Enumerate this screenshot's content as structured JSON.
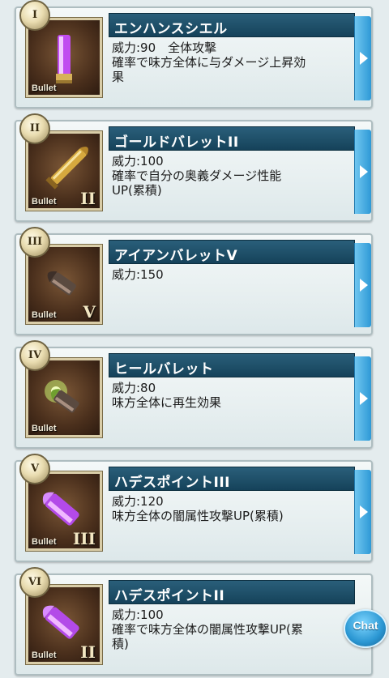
{
  "bullets": [
    {
      "slot": "I",
      "name": "エンハンスシエル",
      "lines": [
        "威力:90　全体攻撃",
        "確率で味方全体に与ダメージ上昇効",
        "果"
      ],
      "thumb_label": "Bullet",
      "grade": "",
      "icon": "shell-purple-icon"
    },
    {
      "slot": "II",
      "name": "ゴールドバレットII",
      "lines": [
        "威力:100",
        "確率で自分の奥義ダメージ性能",
        "UP(累積)"
      ],
      "thumb_label": "Bullet",
      "grade": "II",
      "icon": "gold-bullet-icon"
    },
    {
      "slot": "III",
      "name": "アイアンバレットV",
      "lines": [
        "威力:150"
      ],
      "thumb_label": "Bullet",
      "grade": "V",
      "icon": "iron-bullet-icon"
    },
    {
      "slot": "IV",
      "name": "ヒールバレット",
      "lines": [
        "威力:80",
        "味方全体に再生効果"
      ],
      "thumb_label": "Bullet",
      "grade": "",
      "icon": "heal-bullet-icon"
    },
    {
      "slot": "V",
      "name": "ハデスポイントIII",
      "lines": [
        "威力:120",
        "味方全体の闇属性攻撃UP(累積)"
      ],
      "thumb_label": "Bullet",
      "grade": "III",
      "icon": "hades-point-icon"
    },
    {
      "slot": "VI",
      "name": "ハデスポイントII",
      "lines": [
        "威力:100",
        "確率で味方全体の闇属性攻撃UP(累",
        "積)"
      ],
      "thumb_label": "Bullet",
      "grade": "II",
      "icon": "hades-point-icon"
    }
  ],
  "chat": {
    "label": "Chat"
  }
}
